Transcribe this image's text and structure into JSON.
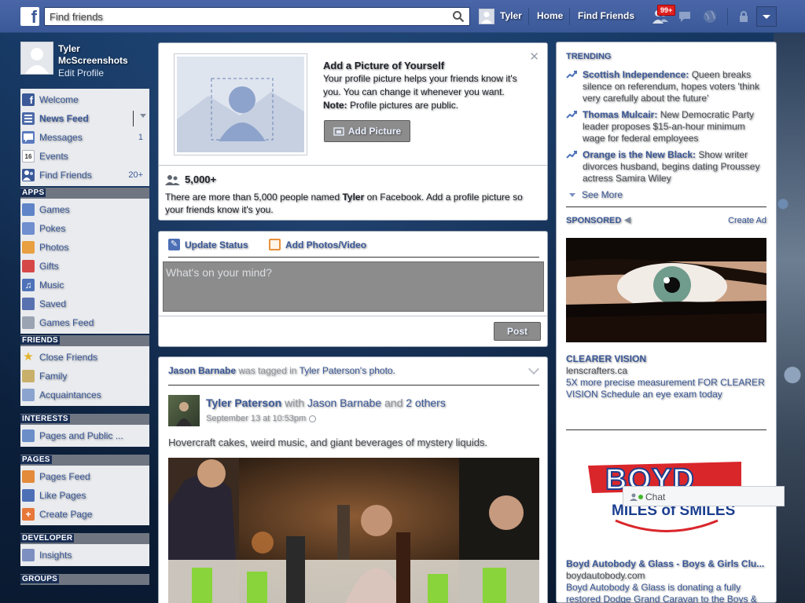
{
  "topbar": {
    "search_placeholder": "Find friends",
    "user_name": "Tyler",
    "home": "Home",
    "find_friends": "Find Friends",
    "notification_count": "99+"
  },
  "leftnav": {
    "profile_name": "Tyler McScreenshots",
    "edit_profile": "Edit Profile",
    "main_items": [
      {
        "label": "Welcome",
        "icon": "facebook-icon",
        "count": ""
      },
      {
        "label": "News Feed",
        "icon": "news-feed-icon",
        "count": ""
      },
      {
        "label": "Messages",
        "icon": "messages-icon",
        "count": "1"
      },
      {
        "label": "Events",
        "icon": "events-icon",
        "count": ""
      },
      {
        "label": "Find Friends",
        "icon": "find-friends-icon",
        "count": "20+"
      }
    ],
    "events_icon_text": "16",
    "apps_header": "APPS",
    "apps_items": [
      {
        "label": "Games",
        "icon": "games-icon"
      },
      {
        "label": "Pokes",
        "icon": "pokes-icon"
      },
      {
        "label": "Photos",
        "icon": "photos-icon"
      },
      {
        "label": "Gifts",
        "icon": "gifts-icon"
      },
      {
        "label": "Music",
        "icon": "music-icon"
      },
      {
        "label": "Saved",
        "icon": "saved-icon"
      },
      {
        "label": "Games Feed",
        "icon": "games-feed-icon"
      }
    ],
    "friends_header": "FRIENDS",
    "friends_items": [
      {
        "label": "Close Friends",
        "icon": "star-icon"
      },
      {
        "label": "Family",
        "icon": "family-icon"
      },
      {
        "label": "Acquaintances",
        "icon": "acquaintances-icon"
      }
    ],
    "interests_header": "INTERESTS",
    "interests_items": [
      {
        "label": "Pages and Public ...",
        "icon": "rss-icon"
      }
    ],
    "pages_header": "PAGES",
    "pages_items": [
      {
        "label": "Pages Feed",
        "icon": "megaphone-icon"
      },
      {
        "label": "Like Pages",
        "icon": "thumbs-up-icon"
      },
      {
        "label": "Create Page",
        "icon": "create-page-icon"
      }
    ],
    "developer_header": "DEVELOPER",
    "developer_items": [
      {
        "label": "Insights",
        "icon": "insights-icon"
      }
    ],
    "groups_header": "GROUPS"
  },
  "profile_prompt": {
    "title": "Add a Picture of Yourself",
    "body": "Your profile picture helps your friends know it's you. You can change it whenever you want.",
    "note_label": "Note:",
    "note_text": "Profile pictures are public.",
    "button": "Add Picture",
    "count": "5,000+",
    "people_pre": "There are more than 5,000 people named ",
    "people_name": "Tyler",
    "people_post": " on Facebook. Add a profile picture so your friends know it's you."
  },
  "composer": {
    "tab_status": "Update Status",
    "tab_photos": "Add Photos/Video",
    "placeholder": "What's on your mind?",
    "post": "Post"
  },
  "story": {
    "tag_actor": "Jason Barnabe",
    "tag_middle": " was tagged in ",
    "tag_target": "Tyler Paterson's photo.",
    "author": "Tyler Paterson",
    "with_word": " with ",
    "with_friend": "Jason Barnabe",
    "and_word": " and ",
    "others": "2 others",
    "timestamp": "September 13 at 10:53pm",
    "text": "Hovercraft cakes, weird music, and giant beverages of mystery liquids."
  },
  "right": {
    "trending_title": "TRENDING",
    "trends": [
      {
        "topic": "Scottish Independence:",
        "text": " Queen breaks silence on referendum, hopes voters 'think very carefully about the future'"
      },
      {
        "topic": "Thomas Mulcair:",
        "text": " New Democratic Party leader proposes $15-an-hour minimum wage for federal employees"
      },
      {
        "topic": "Orange is the New Black:",
        "text": " Show writer divorces husband, begins dating Proussey actress Samira Wiley"
      }
    ],
    "see_more": "See More",
    "sponsored_title": "SPONSORED",
    "create_ad": "Create Ad",
    "ad1": {
      "title": "CLEARER VISION",
      "domain": "lenscrafters.ca",
      "text": "5X more precise measurement FOR CLEARER VISION Schedule an eye exam today"
    },
    "ad2": {
      "logo": "BOYD",
      "tagline": "MILES of SMILES",
      "title": "Boyd Autobody & Glass - Boys & Girls Clu...",
      "domain": "boydautobody.com",
      "text": "Boyd Autobody & Glass is donating a fully restored Dodge Grand Caravan to the Boys &"
    },
    "chat": "Chat"
  },
  "colors": {
    "brand": "#3b5998",
    "topbar": "#3b5998",
    "link": "#3b5998",
    "badge": "#e02020"
  }
}
